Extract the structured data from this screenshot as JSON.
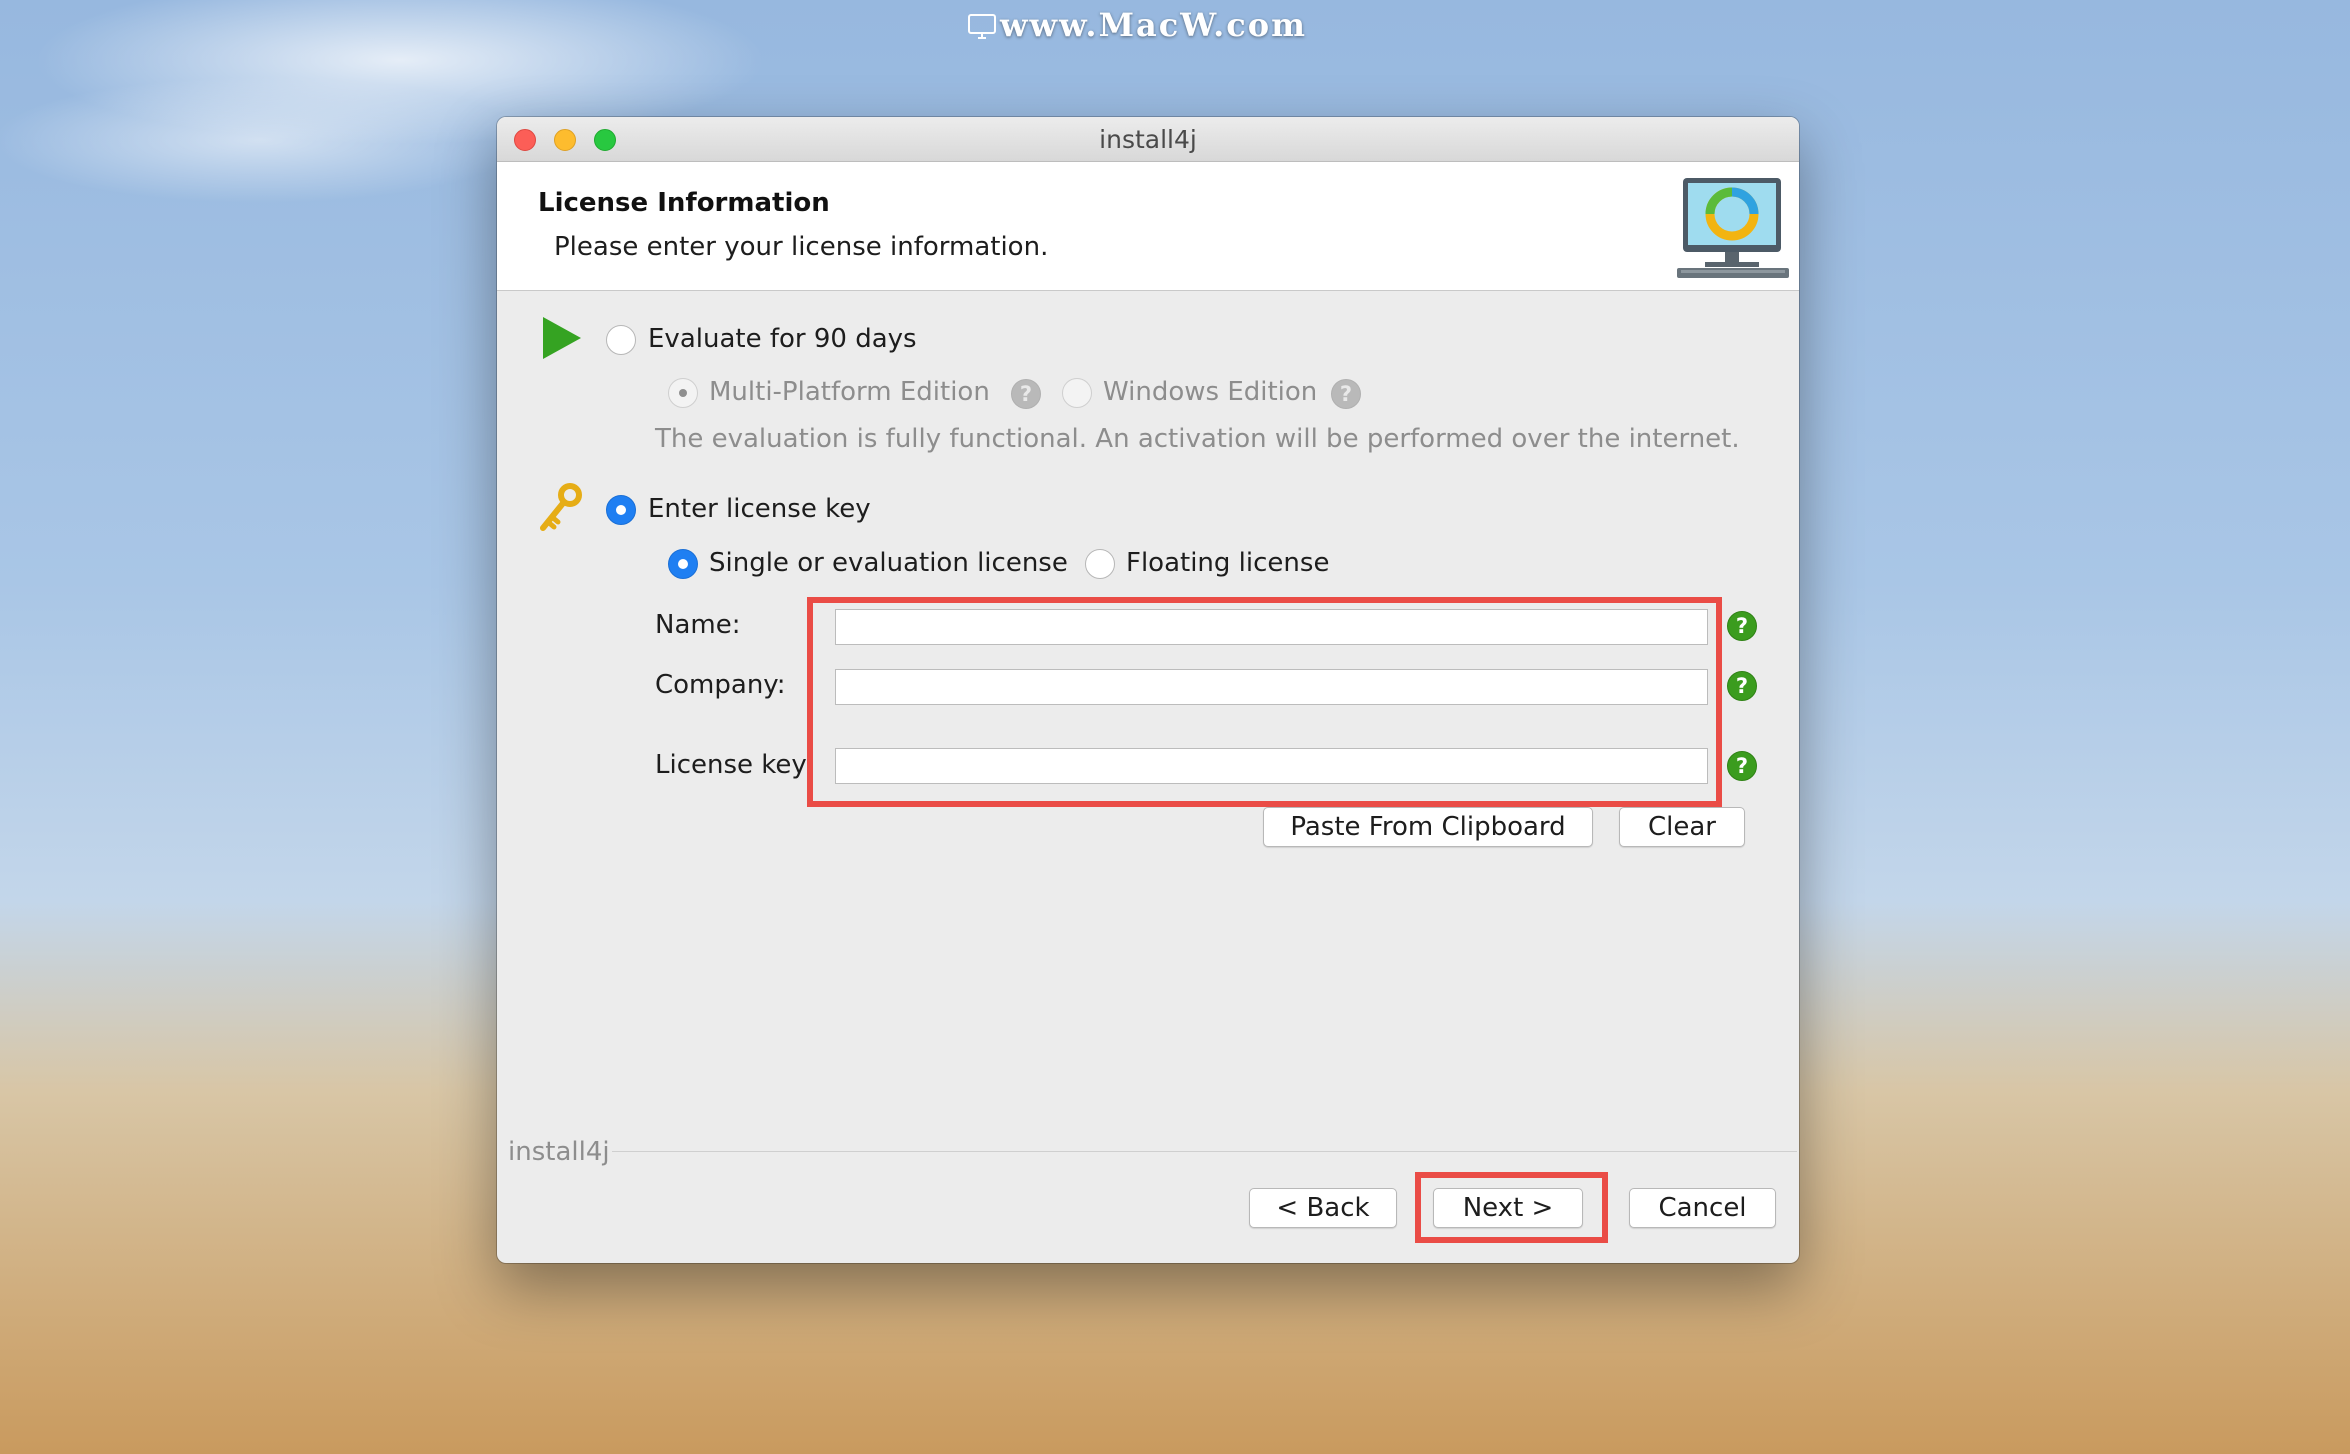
{
  "watermark": "www.MacW.com",
  "window": {
    "title": "install4j"
  },
  "header": {
    "title": "License Information",
    "subtitle": "Please enter your license information."
  },
  "evaluate": {
    "label": "Evaluate for 90 days",
    "selected": false,
    "editions": [
      {
        "label": "Multi-Platform Edition",
        "selected": true
      },
      {
        "label": "Windows Edition",
        "selected": false
      }
    ],
    "note": "The evaluation is fully functional. An activation will be performed over the internet."
  },
  "license": {
    "label": "Enter license key",
    "selected": true,
    "types": [
      {
        "label": "Single or evaluation license",
        "selected": true
      },
      {
        "label": "Floating license",
        "selected": false
      }
    ],
    "fields": {
      "name_label": "Name:",
      "name_value": "",
      "company_label": "Company:",
      "company_value": "",
      "key_label": "License key:",
      "key_value": ""
    },
    "paste_button": "Paste From Clipboard",
    "clear_button": "Clear"
  },
  "footer": {
    "brand": "install4j",
    "back_button": "< Back",
    "next_button": "Next >",
    "cancel_button": "Cancel"
  },
  "colors": {
    "accent": "#1f7ff2",
    "help": "#3b9c1e",
    "highlight": "#ea4c46"
  }
}
